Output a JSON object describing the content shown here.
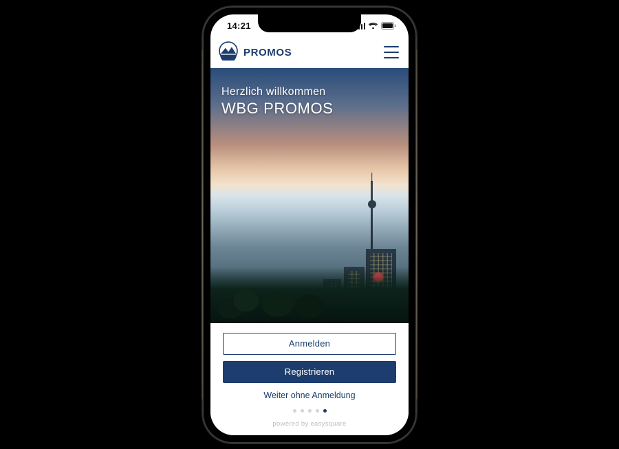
{
  "status": {
    "time": "14:21"
  },
  "header": {
    "brand": "PROMOS"
  },
  "hero": {
    "subtitle": "Herzlich willkommen",
    "title": "WBG PROMOS"
  },
  "actions": {
    "login": "Anmelden",
    "register": "Registrieren",
    "skip": "Weiter ohne Anmeldung"
  },
  "pager": {
    "count": 5,
    "active_index": 4
  },
  "footer": {
    "powered_by": "powered by easysquare"
  },
  "colors": {
    "primary": "#1C3D6E"
  }
}
